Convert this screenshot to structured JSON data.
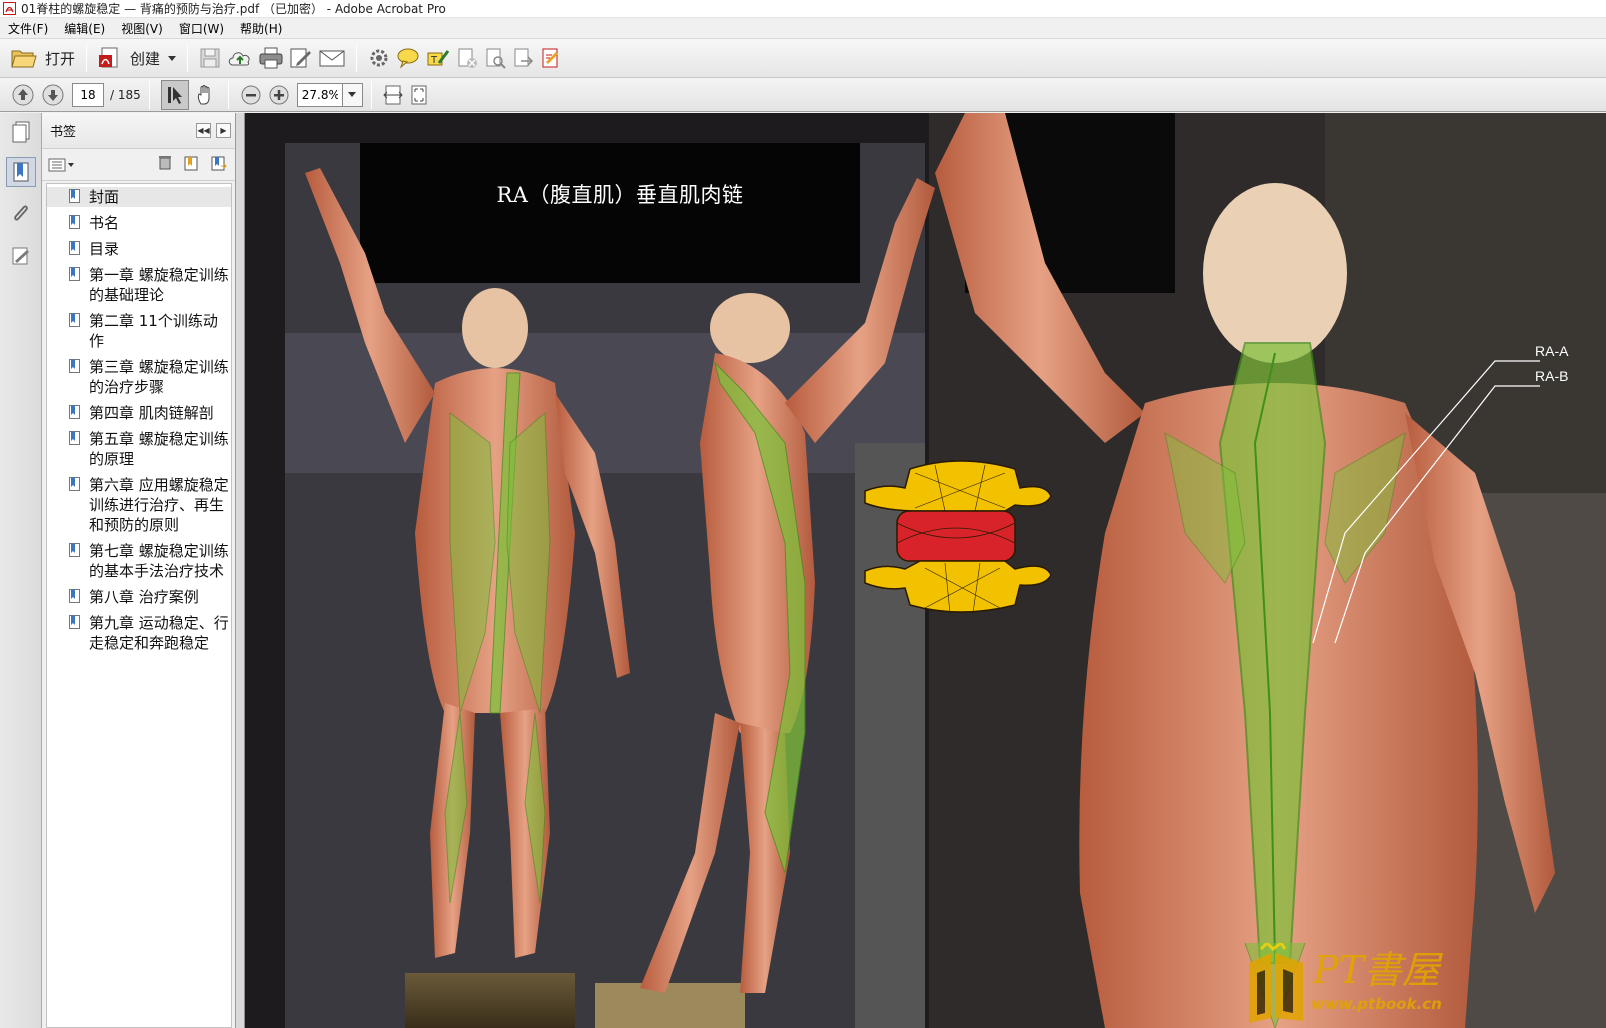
{
  "window": {
    "title": "01脊柱的螺旋稳定 — 背痛的预防与治疗.pdf （已加密） - Adobe Acrobat Pro"
  },
  "menu": [
    "文件(F)",
    "编辑(E)",
    "视图(V)",
    "窗口(W)",
    "帮助(H)"
  ],
  "toolbar": {
    "open_label": "打开",
    "create_label": "创建"
  },
  "nav": {
    "page_current": "18",
    "page_total": "/ 185",
    "zoom": "27.8%"
  },
  "bookmarks": {
    "title": "书签",
    "items": [
      {
        "label": "封面",
        "selected": true
      },
      {
        "label": "书名"
      },
      {
        "label": "目录"
      },
      {
        "label": "第一章 螺旋稳定训练的基础理论"
      },
      {
        "label": "第二章 11个训练动作"
      },
      {
        "label": "第三章 螺旋稳定训练的治疗步骤"
      },
      {
        "label": "第四章 肌肉链解剖"
      },
      {
        "label": "第五章 螺旋稳定训练的原理"
      },
      {
        "label": "第六章 应用螺旋稳定训练进行治疗、再生和预防的原则"
      },
      {
        "label": "第七章 螺旋稳定训练的基本手法治疗技术"
      },
      {
        "label": "第八章 治疗案例"
      },
      {
        "label": "第九章 运动稳定、行走稳定和奔跑稳定"
      }
    ]
  },
  "document": {
    "heading": "RA（腹直肌）垂直肌肉链",
    "label_a": "RA-A",
    "label_b": "RA-B",
    "watermark_text": "PT書屋",
    "watermark_url": "www.ptbook.cn"
  },
  "colors": {
    "muscle_chain": "#7fbf3a",
    "vertebra_yellow": "#f2c200",
    "vertebra_red": "#d8232a",
    "skin": "#d98a6a"
  }
}
